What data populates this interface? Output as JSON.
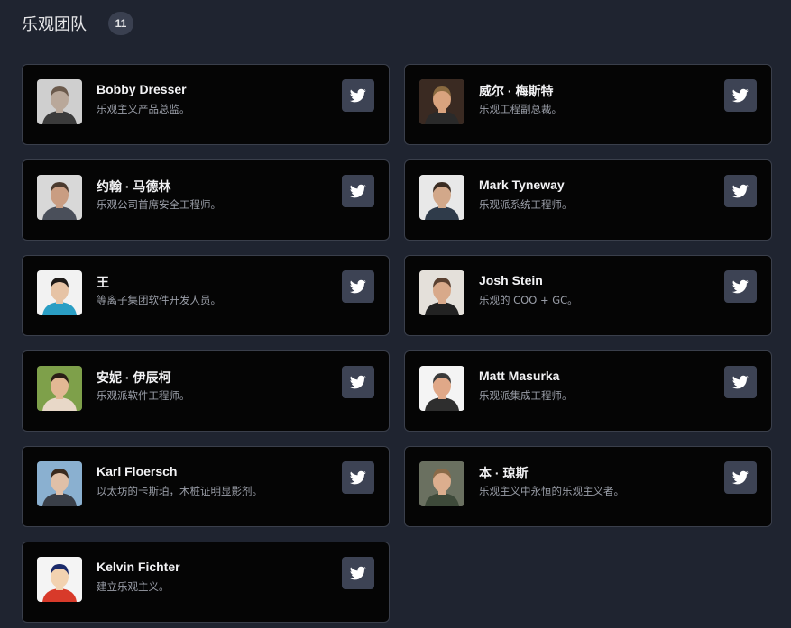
{
  "header": {
    "title": "乐观团队",
    "count": "11"
  },
  "members": [
    {
      "name": "Bobby Dresser",
      "bio": "乐观主义产品总监。",
      "avatar": {
        "bg": "#cfcfcf",
        "skin": "#b9a89a",
        "hair": "#6b5a4c",
        "shirt": "#3b3b3b"
      }
    },
    {
      "name": "威尔 · 梅斯特",
      "bio": "乐观工程副总裁。",
      "avatar": {
        "bg": "#3a2a22",
        "skin": "#d9a37e",
        "hair": "#8a6a40",
        "shirt": "#2a2a2a"
      }
    },
    {
      "name": "约翰 · 马德林",
      "bio": "乐观公司首席安全工程师。",
      "avatar": {
        "bg": "#d8d8d8",
        "skin": "#c99d82",
        "hair": "#4a3a2e",
        "shirt": "#4a4f5a"
      }
    },
    {
      "name": "Mark Tyneway",
      "bio": "乐观派系统工程师。",
      "avatar": {
        "bg": "#e8e8e8",
        "skin": "#d2a88a",
        "hair": "#3a2c22",
        "shirt": "#2f3b4a"
      }
    },
    {
      "name": "王",
      "bio": "等离子集团软件开发人员。",
      "avatar": {
        "bg": "#f2f2f2",
        "skin": "#e6c3a5",
        "hair": "#1e1a18",
        "shirt": "#2a9ec4"
      }
    },
    {
      "name": "Josh Stein",
      "bio": "乐观的 COO + GC。",
      "avatar": {
        "bg": "#e4e0da",
        "skin": "#d8a98a",
        "hair": "#5a4030",
        "shirt": "#222222"
      }
    },
    {
      "name": "安妮 · 伊辰柯",
      "bio": "乐观派软件工程师。",
      "avatar": {
        "bg": "#7ea04a",
        "skin": "#e2b894",
        "hair": "#2a1e16",
        "shirt": "#e8d8c8"
      }
    },
    {
      "name": "Matt Masurka",
      "bio": "乐观派集成工程师。",
      "avatar": {
        "bg": "#f4f4f4",
        "skin": "#e0a888",
        "hair": "#3a3a3a",
        "shirt": "#2e2e2e"
      }
    },
    {
      "name": "Karl Floersch",
      "bio": "以太坊的卡斯珀，木桩证明显影剂。",
      "avatar": {
        "bg": "#8ab0d0",
        "skin": "#e0c0a8",
        "hair": "#3a2a1e",
        "shirt": "#3a3f48"
      }
    },
    {
      "name": "本 · 琼斯",
      "bio": "乐观主义中永恒的乐观主义者。",
      "avatar": {
        "bg": "#6a7060",
        "skin": "#dcae8e",
        "hair": "#8a6a48",
        "shirt": "#3e4a3a"
      }
    },
    {
      "name": "Kelvin Fichter",
      "bio": "建立乐观主义。",
      "avatar": {
        "bg": "#f4f4f4",
        "skin": "#f2d2b0",
        "hair": "#1a2a6a",
        "shirt": "#d83a2a"
      }
    }
  ],
  "icons": {
    "social": "twitter-icon",
    "twitter_color": "#ffffff"
  }
}
